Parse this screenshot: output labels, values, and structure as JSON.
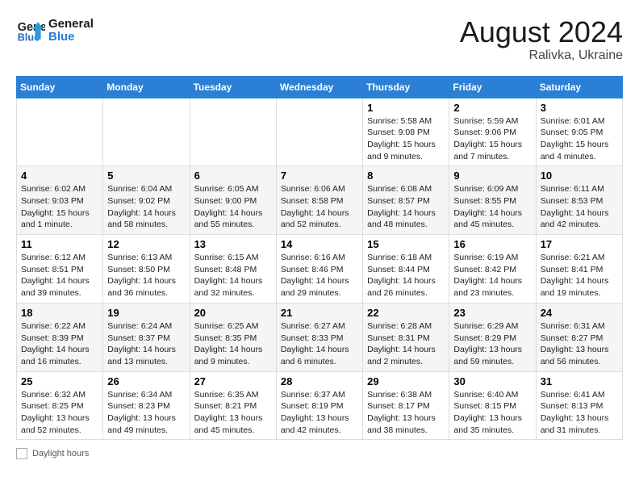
{
  "header": {
    "logo_line1": "General",
    "logo_line2": "Blue",
    "month_year": "August 2024",
    "location": "Ralivka, Ukraine"
  },
  "days_of_week": [
    "Sunday",
    "Monday",
    "Tuesday",
    "Wednesday",
    "Thursday",
    "Friday",
    "Saturday"
  ],
  "weeks": [
    [
      {
        "day": "",
        "info": ""
      },
      {
        "day": "",
        "info": ""
      },
      {
        "day": "",
        "info": ""
      },
      {
        "day": "",
        "info": ""
      },
      {
        "day": "1",
        "info": "Sunrise: 5:58 AM\nSunset: 9:08 PM\nDaylight: 15 hours and 9 minutes."
      },
      {
        "day": "2",
        "info": "Sunrise: 5:59 AM\nSunset: 9:06 PM\nDaylight: 15 hours and 7 minutes."
      },
      {
        "day": "3",
        "info": "Sunrise: 6:01 AM\nSunset: 9:05 PM\nDaylight: 15 hours and 4 minutes."
      }
    ],
    [
      {
        "day": "4",
        "info": "Sunrise: 6:02 AM\nSunset: 9:03 PM\nDaylight: 15 hours and 1 minute."
      },
      {
        "day": "5",
        "info": "Sunrise: 6:04 AM\nSunset: 9:02 PM\nDaylight: 14 hours and 58 minutes."
      },
      {
        "day": "6",
        "info": "Sunrise: 6:05 AM\nSunset: 9:00 PM\nDaylight: 14 hours and 55 minutes."
      },
      {
        "day": "7",
        "info": "Sunrise: 6:06 AM\nSunset: 8:58 PM\nDaylight: 14 hours and 52 minutes."
      },
      {
        "day": "8",
        "info": "Sunrise: 6:08 AM\nSunset: 8:57 PM\nDaylight: 14 hours and 48 minutes."
      },
      {
        "day": "9",
        "info": "Sunrise: 6:09 AM\nSunset: 8:55 PM\nDaylight: 14 hours and 45 minutes."
      },
      {
        "day": "10",
        "info": "Sunrise: 6:11 AM\nSunset: 8:53 PM\nDaylight: 14 hours and 42 minutes."
      }
    ],
    [
      {
        "day": "11",
        "info": "Sunrise: 6:12 AM\nSunset: 8:51 PM\nDaylight: 14 hours and 39 minutes."
      },
      {
        "day": "12",
        "info": "Sunrise: 6:13 AM\nSunset: 8:50 PM\nDaylight: 14 hours and 36 minutes."
      },
      {
        "day": "13",
        "info": "Sunrise: 6:15 AM\nSunset: 8:48 PM\nDaylight: 14 hours and 32 minutes."
      },
      {
        "day": "14",
        "info": "Sunrise: 6:16 AM\nSunset: 8:46 PM\nDaylight: 14 hours and 29 minutes."
      },
      {
        "day": "15",
        "info": "Sunrise: 6:18 AM\nSunset: 8:44 PM\nDaylight: 14 hours and 26 minutes."
      },
      {
        "day": "16",
        "info": "Sunrise: 6:19 AM\nSunset: 8:42 PM\nDaylight: 14 hours and 23 minutes."
      },
      {
        "day": "17",
        "info": "Sunrise: 6:21 AM\nSunset: 8:41 PM\nDaylight: 14 hours and 19 minutes."
      }
    ],
    [
      {
        "day": "18",
        "info": "Sunrise: 6:22 AM\nSunset: 8:39 PM\nDaylight: 14 hours and 16 minutes."
      },
      {
        "day": "19",
        "info": "Sunrise: 6:24 AM\nSunset: 8:37 PM\nDaylight: 14 hours and 13 minutes."
      },
      {
        "day": "20",
        "info": "Sunrise: 6:25 AM\nSunset: 8:35 PM\nDaylight: 14 hours and 9 minutes."
      },
      {
        "day": "21",
        "info": "Sunrise: 6:27 AM\nSunset: 8:33 PM\nDaylight: 14 hours and 6 minutes."
      },
      {
        "day": "22",
        "info": "Sunrise: 6:28 AM\nSunset: 8:31 PM\nDaylight: 14 hours and 2 minutes."
      },
      {
        "day": "23",
        "info": "Sunrise: 6:29 AM\nSunset: 8:29 PM\nDaylight: 13 hours and 59 minutes."
      },
      {
        "day": "24",
        "info": "Sunrise: 6:31 AM\nSunset: 8:27 PM\nDaylight: 13 hours and 56 minutes."
      }
    ],
    [
      {
        "day": "25",
        "info": "Sunrise: 6:32 AM\nSunset: 8:25 PM\nDaylight: 13 hours and 52 minutes."
      },
      {
        "day": "26",
        "info": "Sunrise: 6:34 AM\nSunset: 8:23 PM\nDaylight: 13 hours and 49 minutes."
      },
      {
        "day": "27",
        "info": "Sunrise: 6:35 AM\nSunset: 8:21 PM\nDaylight: 13 hours and 45 minutes."
      },
      {
        "day": "28",
        "info": "Sunrise: 6:37 AM\nSunset: 8:19 PM\nDaylight: 13 hours and 42 minutes."
      },
      {
        "day": "29",
        "info": "Sunrise: 6:38 AM\nSunset: 8:17 PM\nDaylight: 13 hours and 38 minutes."
      },
      {
        "day": "30",
        "info": "Sunrise: 6:40 AM\nSunset: 8:15 PM\nDaylight: 13 hours and 35 minutes."
      },
      {
        "day": "31",
        "info": "Sunrise: 6:41 AM\nSunset: 8:13 PM\nDaylight: 13 hours and 31 minutes."
      }
    ]
  ],
  "footer": {
    "label": "Daylight hours"
  }
}
